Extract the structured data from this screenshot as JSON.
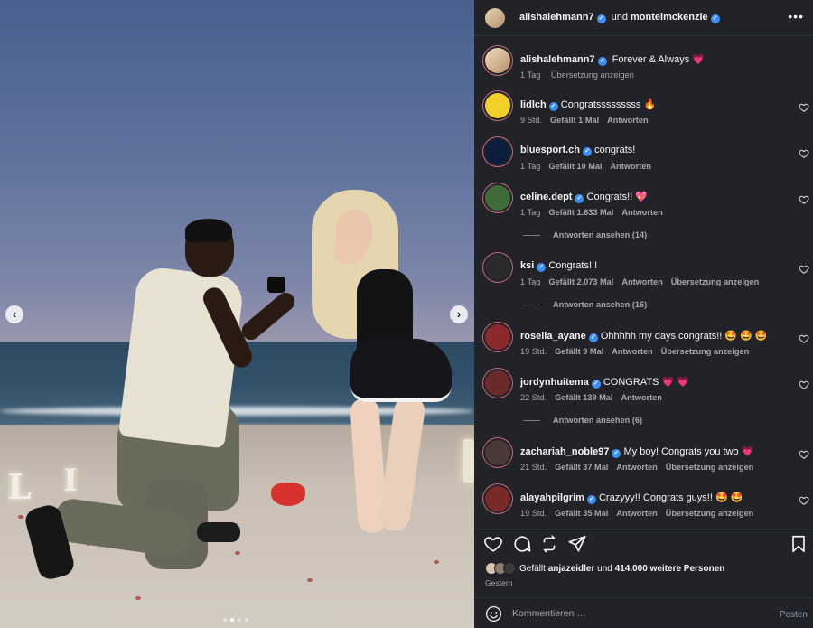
{
  "post": {
    "carousel": {
      "slide_count": 4,
      "active_index": 1
    },
    "photo_letters": [
      "L",
      "O",
      "E"
    ]
  },
  "header": {
    "author1": "alishalehmann7",
    "connector": "und",
    "author2": "montelmckenzie",
    "more_icon": "more-horizontal-icon"
  },
  "caption": {
    "user": "alishalehmann7",
    "text": "Forever & Always",
    "emoji": "💗",
    "time": "1 Tag",
    "translate": "Übersetzung anzeigen"
  },
  "comments": [
    {
      "user": "lidlch",
      "text": "Congratsssssssss",
      "emoji": "🔥",
      "time": "9 Std.",
      "likes": "Gefällt 1 Mal",
      "reply": "Antworten",
      "translate": "",
      "avatar_color": "#f1d02a"
    },
    {
      "user": "bluesport.ch",
      "text": "congrats!",
      "emoji": "",
      "time": "1 Tag",
      "likes": "Gefällt 10 Mal",
      "reply": "Antworten",
      "translate": "",
      "avatar_color": "#0e1c3d"
    },
    {
      "user": "celine.dept",
      "text": "Congrats!!",
      "emoji": "💖",
      "time": "1 Tag",
      "likes": "Gefällt 1.633 Mal",
      "reply": "Antworten",
      "translate": "",
      "avatar_color": "#3f6b3a",
      "replies": "Antworten ansehen (14)"
    },
    {
      "user": "ksi",
      "text": "Congrats!!!",
      "emoji": "",
      "time": "1 Tag",
      "likes": "Gefällt 2.073 Mal",
      "reply": "Antworten",
      "translate": "Übersetzung anzeigen",
      "avatar_color": "#2a2a2a",
      "replies": "Antworten ansehen (16)"
    },
    {
      "user": "rosella_ayane",
      "text": "Ohhhhh my days congrats!!",
      "emoji": "🤩 🤩 🤩",
      "time": "19 Std.",
      "likes": "Gefällt 9 Mal",
      "reply": "Antworten",
      "translate": "Übersetzung anzeigen",
      "avatar_color": "#8a2a2e"
    },
    {
      "user": "jordynhuitema",
      "text": "CONGRATS",
      "emoji": "💗 💗",
      "time": "22 Std.",
      "likes": "Gefällt 139 Mal",
      "reply": "Antworten",
      "translate": "",
      "avatar_color": "#6b2a2a",
      "replies": "Antworten ansehen (6)"
    },
    {
      "user": "zachariah_noble97",
      "text": "My boy! Congrats you two",
      "emoji": "💗",
      "time": "21 Std.",
      "likes": "Gefällt 37 Mal",
      "reply": "Antworten",
      "translate": "Übersetzung anzeigen",
      "avatar_color": "#4a3a36"
    },
    {
      "user": "alayahpilgrim",
      "text": "Crazyyy!! Congrats guys!!",
      "emoji": "🤩 🤩",
      "time": "19 Std.",
      "likes": "Gefällt 35 Mal",
      "reply": "Antworten",
      "translate": "Übersetzung anzeigen",
      "avatar_color": "#7a2a26"
    }
  ],
  "actions": {
    "like_icon": "heart-icon",
    "comment_icon": "comment-icon",
    "repost_icon": "repost-icon",
    "share_icon": "share-icon",
    "save_icon": "bookmark-icon"
  },
  "likes": {
    "prefix": "Gefällt",
    "user": "anjazeidler",
    "connector": "und",
    "count_text": "414.000 weitere Personen",
    "date": "Gestern"
  },
  "composer": {
    "placeholder": "Kommentieren …",
    "post_label": "Posten"
  },
  "colors": {
    "panel_bg": "#212328",
    "verified": "#3c8ef6",
    "muted_text": "#a8a8a8"
  }
}
